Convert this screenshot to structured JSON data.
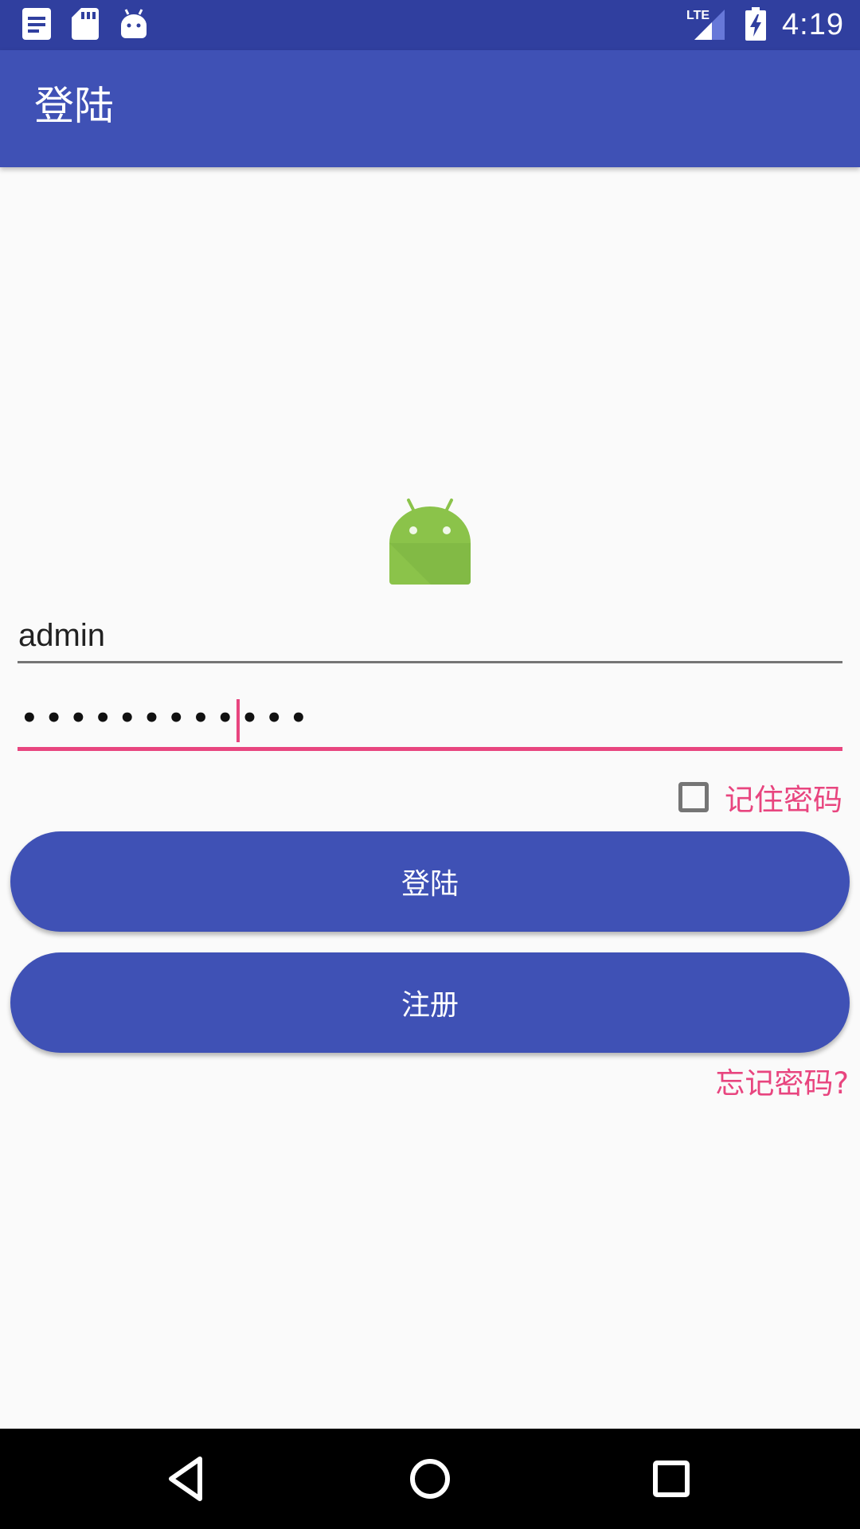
{
  "status_bar": {
    "time": "4:19",
    "network_label": "LTE",
    "left_icons": [
      "notes-icon",
      "sd-card-icon",
      "android-debug-icon"
    ],
    "right_icons": [
      "lte-signal-icon",
      "battery-charging-icon"
    ]
  },
  "app_bar": {
    "title": "登陆"
  },
  "form": {
    "username_value": "admin",
    "password_value": "••••••••••••",
    "remember_label": "记住密码",
    "remember_checked": false,
    "login_button": "登陆",
    "register_button": "注册",
    "forgot_link": "忘记密码?"
  },
  "colors": {
    "primary": "#3f51b5",
    "primary_dark": "#303f9f",
    "accent": "#e8457f",
    "android_green": "#8bc34a"
  }
}
